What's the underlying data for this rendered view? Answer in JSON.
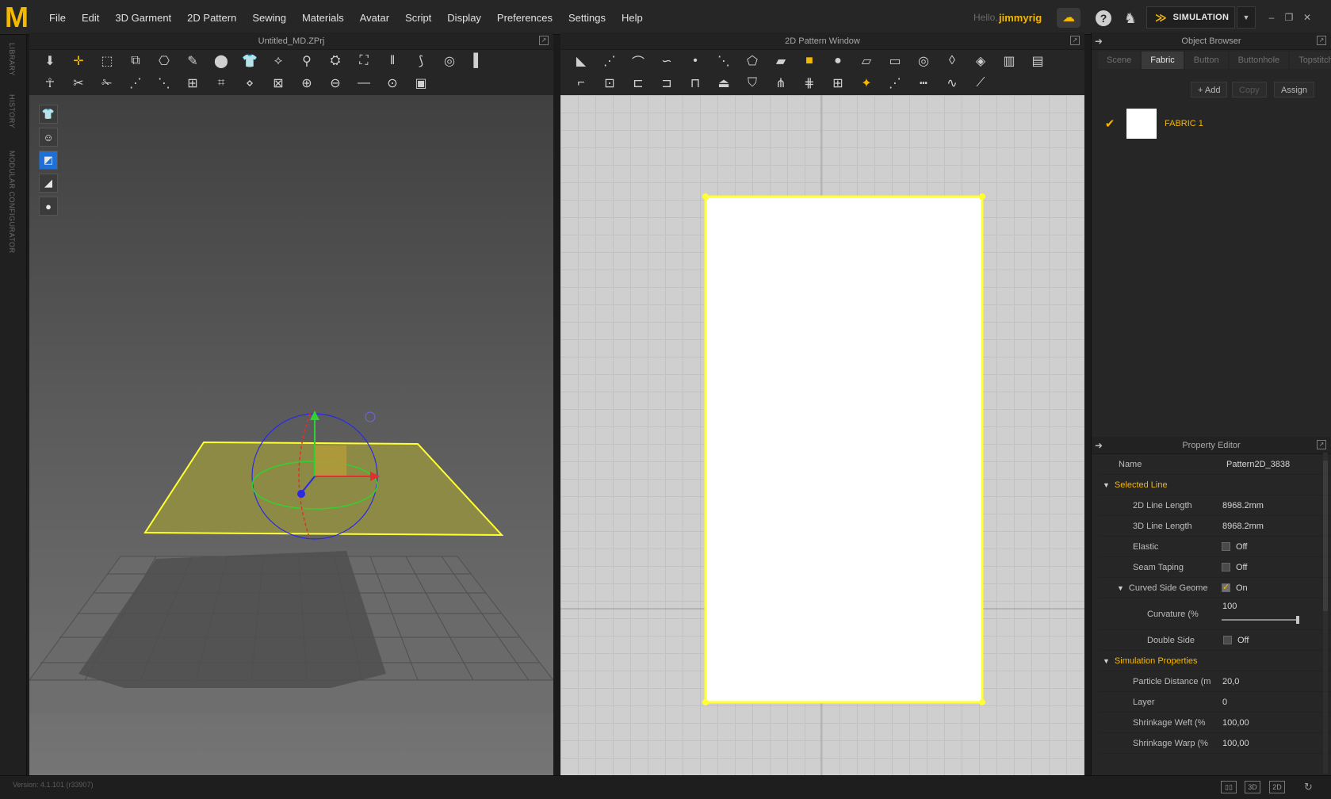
{
  "menubar": {
    "logo": "M",
    "items": [
      "File",
      "Edit",
      "3D Garment",
      "2D Pattern",
      "Sewing",
      "Materials",
      "Avatar",
      "Script",
      "Display",
      "Preferences",
      "Settings",
      "Help"
    ],
    "hello": "Hello,",
    "user": "jimmyrig",
    "simulation_label": "SIMULATION"
  },
  "left_dock": {
    "tabs": [
      "LIBRARY",
      "HISTORY",
      "MODULAR CONFIGURATOR"
    ]
  },
  "panel3d": {
    "title": "Untitled_MD.ZPrj"
  },
  "panel2d": {
    "title": "2D Pattern Window"
  },
  "object_browser": {
    "title": "Object Browser",
    "tabs": [
      "Scene",
      "Fabric",
      "Button",
      "Buttonhole",
      "Topstitch"
    ],
    "active_tab": "Fabric",
    "buttons": {
      "add": "+ Add",
      "copy": "Copy",
      "assign": "Assign"
    },
    "fabrics": [
      {
        "name": "FABRIC 1",
        "color": "#ffffff"
      }
    ]
  },
  "property_editor": {
    "title": "Property Editor",
    "name_label": "Name",
    "name_value": "Pattern2D_3838",
    "selected_line": {
      "label": "Selected Line",
      "line2d_label": "2D Line Length",
      "line2d_value": "8968.2mm",
      "line3d_label": "3D Line Length",
      "line3d_value": "8968.2mm",
      "elastic_label": "Elastic",
      "elastic_value": "Off",
      "seam_label": "Seam Taping",
      "seam_value": "Off",
      "curved_label": "Curved Side Geome",
      "curved_value": "On",
      "curvature_label": "Curvature (%",
      "curvature_value": "100",
      "curvature_level": 1.0,
      "double_label": "Double Side",
      "double_value": "Off"
    },
    "simulation": {
      "label": "Simulation Properties",
      "particle_label": "Particle Distance (m",
      "particle_value": "20,0",
      "layer_label": "Layer",
      "layer_value": "0",
      "weft_label": "Shrinkage Weft (%",
      "weft_value": "100,00",
      "warp_label": "Shrinkage Warp (%",
      "warp_value": "100,00"
    }
  },
  "statusbar": {
    "version": "Version: 4.1.101 (r33907)",
    "view_buttons": [
      "3D",
      "2D"
    ]
  },
  "colors": {
    "accent": "#f5b800",
    "selection": "#ffff33",
    "pattern_fill": "#ffffff"
  }
}
